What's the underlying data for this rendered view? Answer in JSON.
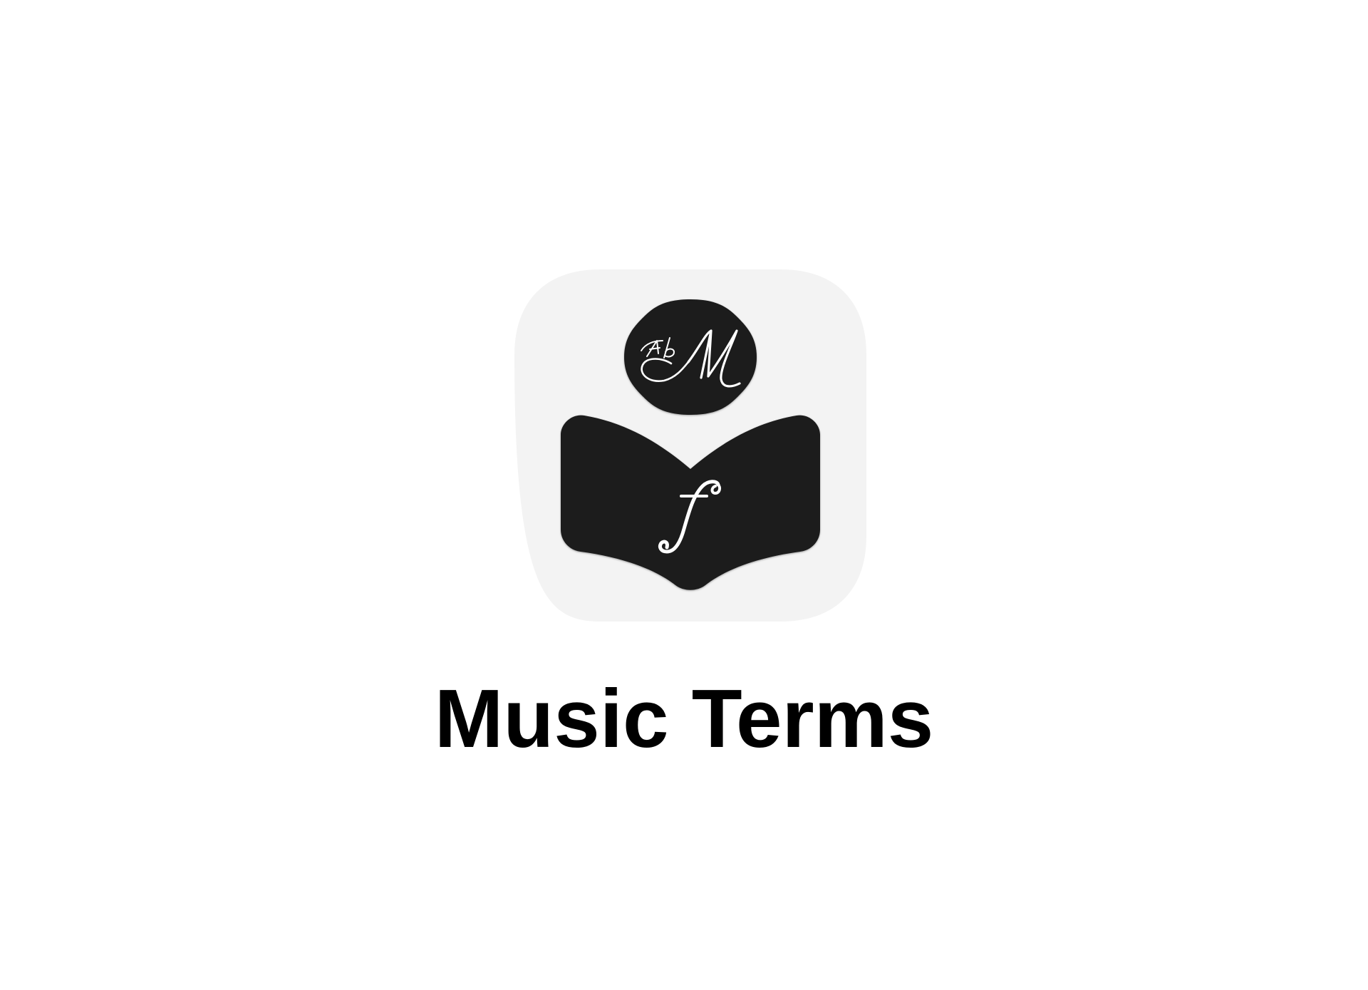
{
  "app": {
    "name": "Music Terms",
    "icon": "music-terms-app-icon",
    "colors": {
      "tile_background": "#f3f3f3",
      "icon_foreground": "#1b1b1b",
      "glyph_color": "#ffffff"
    },
    "icon_glyphs": {
      "badge_monogram": "AbCM",
      "book_symbol": "f"
    }
  }
}
